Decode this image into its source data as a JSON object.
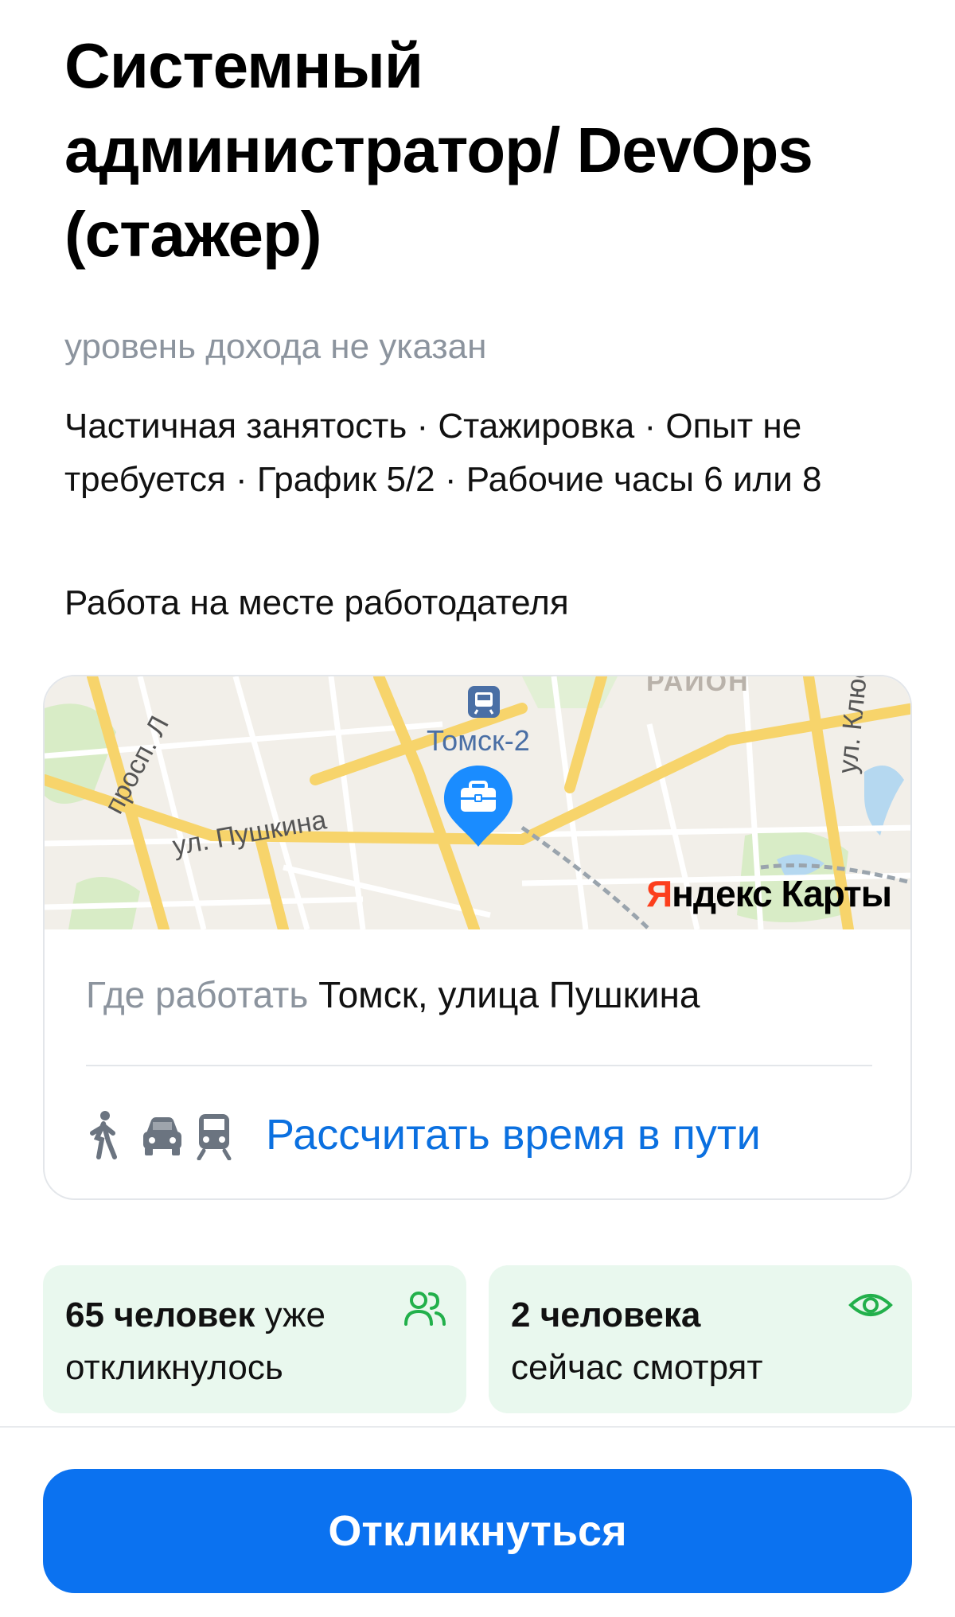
{
  "vacancy": {
    "title": "Системный администратор/ DevOps (стажер)",
    "salary": "уровень дохода не указан",
    "params": "Частичная занятость · Стажировка · Опыт не требуется · График 5/2 · Рабочие часы 6 или 8",
    "work_format": "Работа на месте работодателя"
  },
  "map": {
    "station_label": "Томск-2",
    "street_pushkina": "ул. Пушкина",
    "street_klyueva": "ул. Клюева",
    "street_prosp": "просп. Л",
    "district": "РАЙОН",
    "logo_part1": "Я",
    "logo_part2": "ндекс Карты",
    "pin_icon": "briefcase-icon",
    "accent": "#1a8cff"
  },
  "address": {
    "label": "Где работать",
    "value": "Томск, улица Пушкина"
  },
  "route": {
    "icons": [
      "walking-icon",
      "car-icon",
      "train-icon"
    ],
    "link": "Рассчитать время в пути"
  },
  "stats": {
    "responded_count": "65 человек",
    "responded_text": "уже откликнулось",
    "responded_icon": "people-icon",
    "viewing_count": "2 человека",
    "viewing_text": "сейчас смотрят",
    "viewing_icon": "eye-icon",
    "accent": "#22b04b"
  },
  "action": {
    "respond_label": "Откликнуться",
    "color": "#0b72f0"
  }
}
